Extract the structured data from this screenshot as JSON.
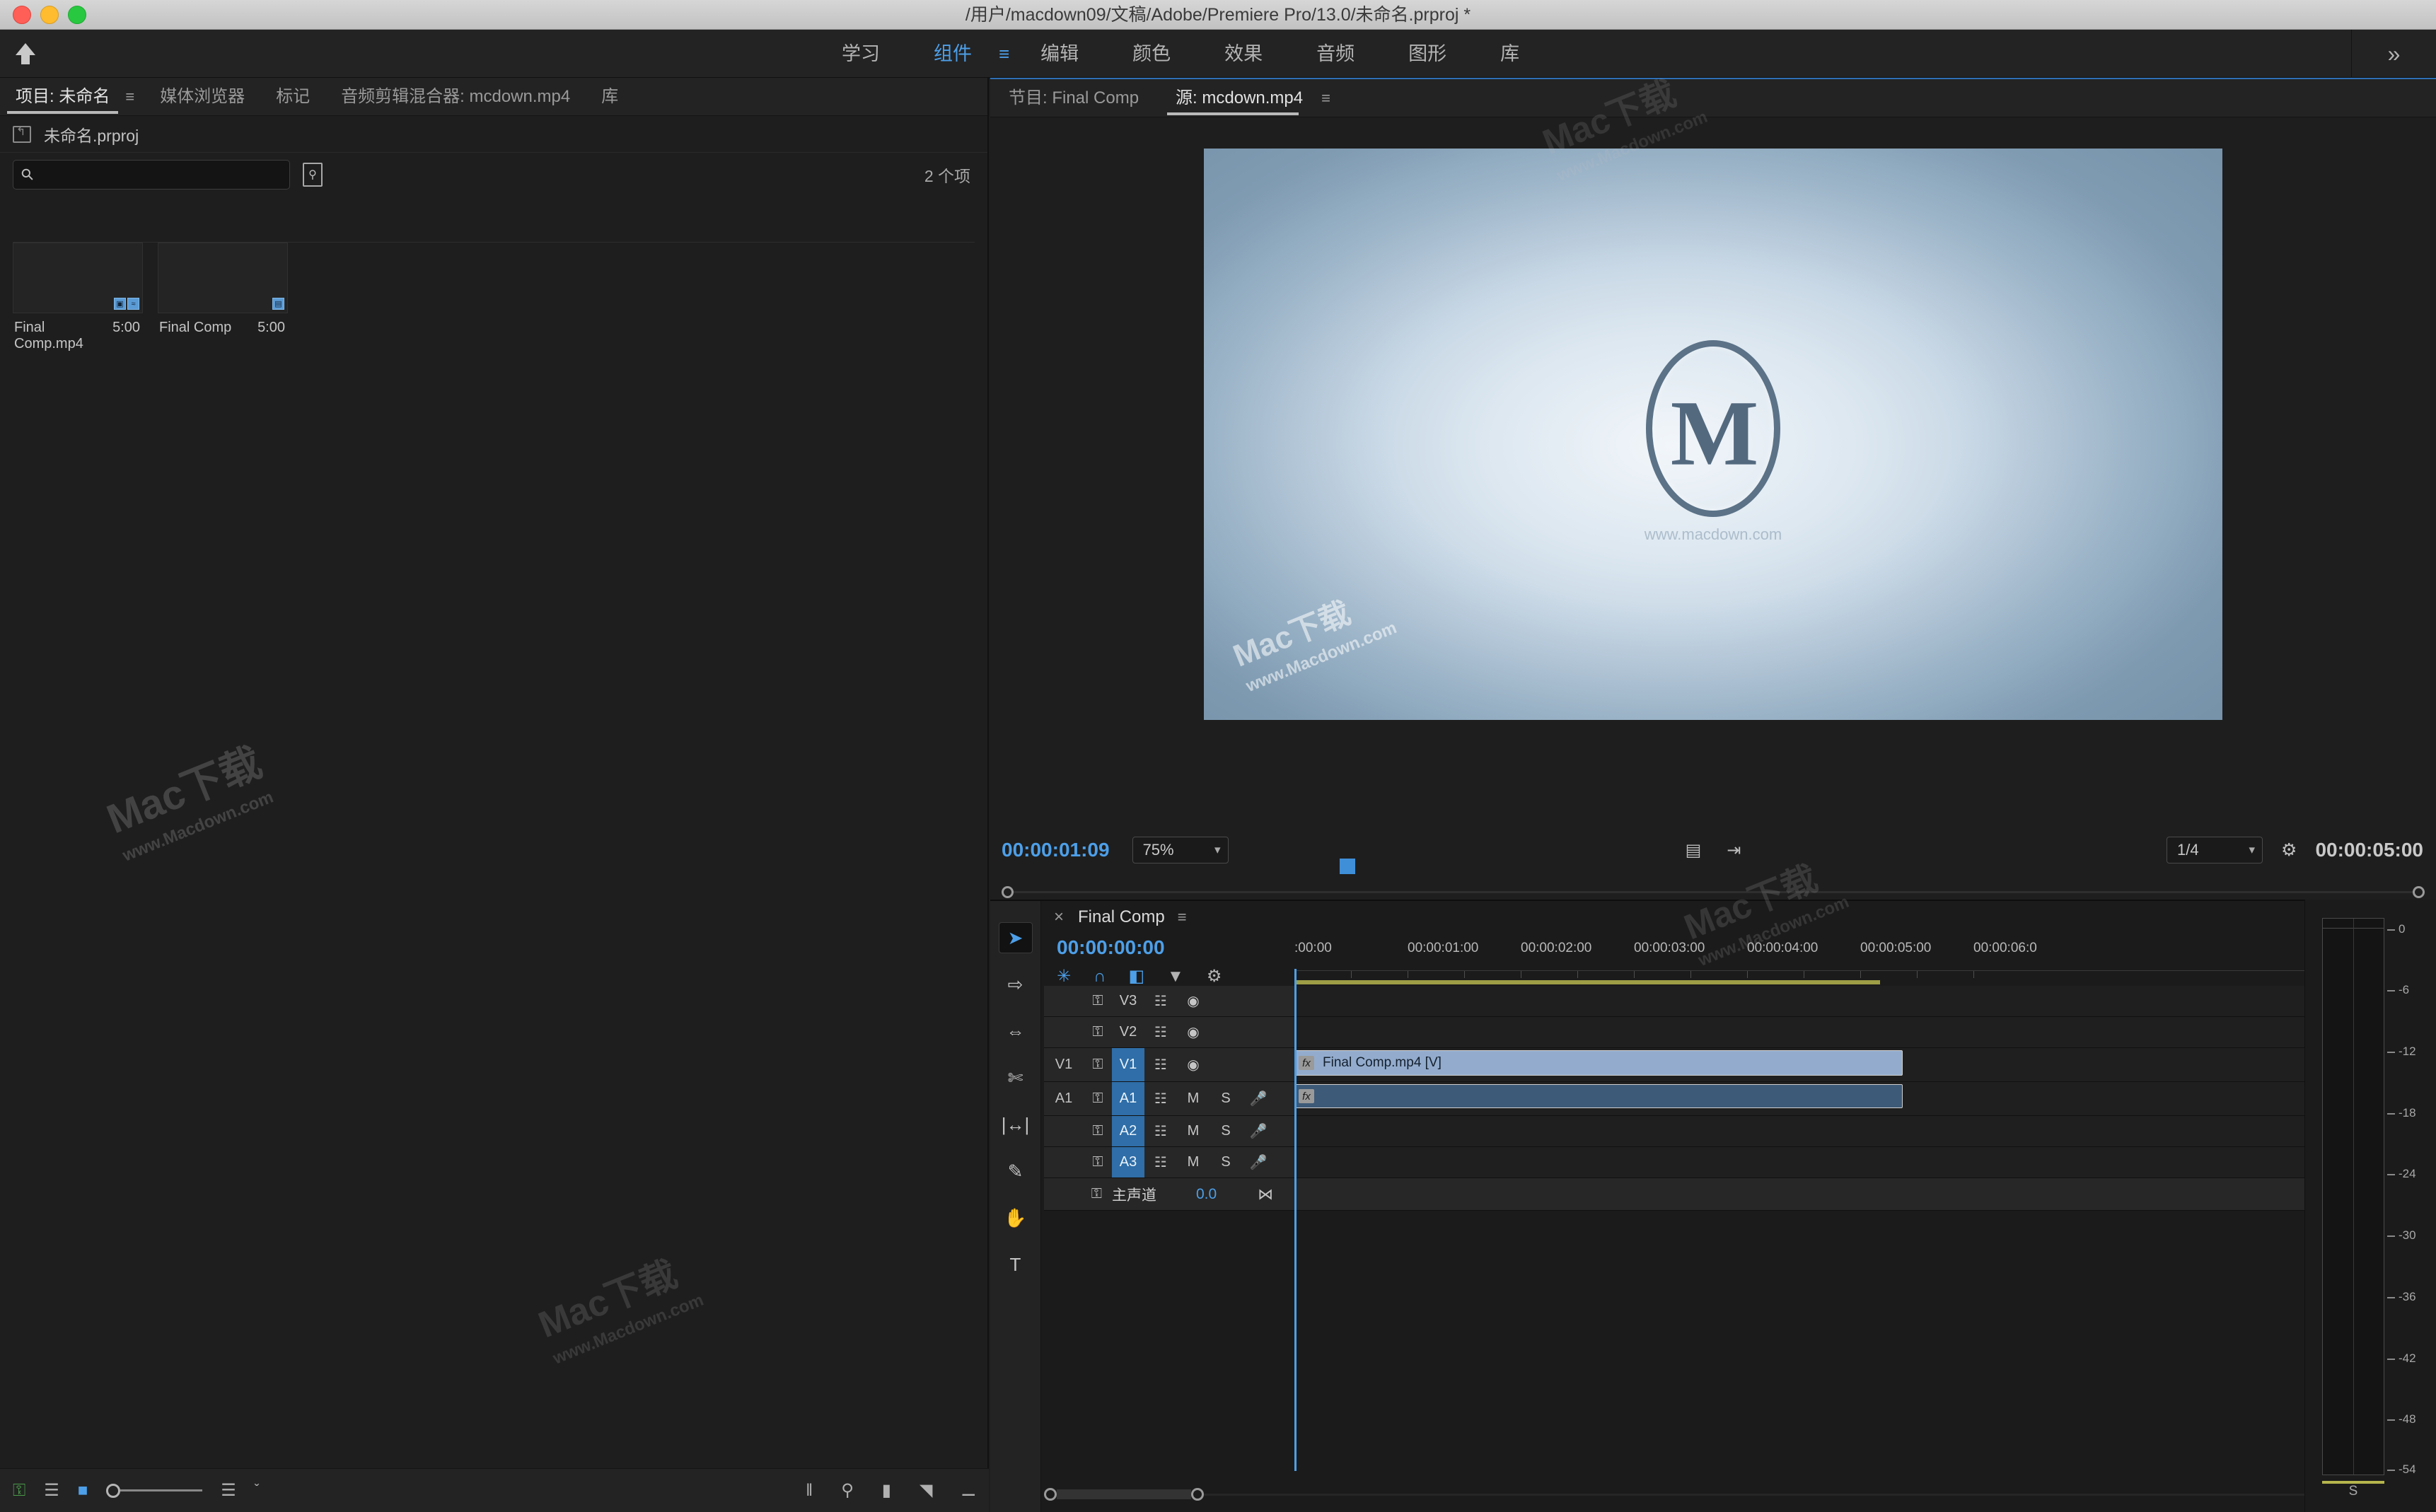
{
  "window": {
    "title": "/用户/macdown09/文稿/Adobe/Premiere Pro/13.0/未命名.prproj *"
  },
  "menubar": {
    "home_icon": "home-icon",
    "items": [
      {
        "label": "学习",
        "active": false
      },
      {
        "label": "组件",
        "active": true
      },
      {
        "label": "编辑",
        "active": false
      },
      {
        "label": "颜色",
        "active": false
      },
      {
        "label": "效果",
        "active": false
      },
      {
        "label": "音频",
        "active": false
      },
      {
        "label": "图形",
        "active": false
      },
      {
        "label": "库",
        "active": false
      }
    ],
    "burger": "≡",
    "more": "»"
  },
  "project": {
    "tabs": [
      {
        "label": "项目: 未命名",
        "active": true
      },
      {
        "label": "媒体浏览器",
        "active": false
      },
      {
        "label": "标记",
        "active": false
      },
      {
        "label": "音频剪辑混合器: mcdown.mp4",
        "active": false
      },
      {
        "label": "库",
        "active": false
      }
    ],
    "burger": "≡",
    "bin_name": "未命名.prproj",
    "search_placeholder": "",
    "search_value": "",
    "item_count": "2 个项",
    "items": [
      {
        "name": "Final Comp.mp4",
        "duration": "5:00",
        "badges": [
          "film-icon",
          "audio-wave-icon"
        ]
      },
      {
        "name": "Final Comp",
        "duration": "5:00",
        "badges": [
          "sequence-icon"
        ]
      }
    ],
    "bottom_tools": [
      {
        "name": "lock-icon",
        "glyph": "⚿"
      },
      {
        "name": "list-view-icon",
        "glyph": "☰"
      },
      {
        "name": "icon-view-icon",
        "glyph": "■"
      },
      {
        "name": "sort-icon",
        "glyph": "☰"
      },
      {
        "name": "sort-chevron-icon",
        "glyph": "ˇ"
      }
    ],
    "bottom_right_tools": [
      {
        "name": "freeform-view-icon",
        "glyph": "‖"
      },
      {
        "name": "find-icon",
        "glyph": "⚲"
      },
      {
        "name": "new-bin-icon",
        "glyph": "▮"
      },
      {
        "name": "new-item-icon",
        "glyph": "◥"
      },
      {
        "name": "delete-icon",
        "glyph": "Ὕ1"
      }
    ]
  },
  "monitor": {
    "tabs": [
      {
        "label": "节目: Final Comp",
        "active": false
      },
      {
        "label": "源: mcdown.mp4",
        "active": true
      }
    ],
    "burger": "≡",
    "playhead_timecode": "00:00:01:09",
    "zoom_level": "75%",
    "resolution": "1/4",
    "duration": "00:00:05:00",
    "logo_letter": "M",
    "logo_sub": "www.macdown.com",
    "transport": [
      {
        "name": "add-marker-icon",
        "glyph": "▼"
      },
      {
        "name": "mark-in-icon",
        "glyph": "{"
      },
      {
        "name": "mark-out-icon",
        "glyph": "}"
      },
      {
        "name": "go-to-in-icon",
        "glyph": "⇥"
      },
      {
        "name": "step-back-icon",
        "glyph": "◀"
      },
      {
        "name": "play-icon",
        "glyph": "▶"
      },
      {
        "name": "step-forward-icon",
        "glyph": "▶"
      },
      {
        "name": "go-to-out-icon",
        "glyph": "⇥"
      },
      {
        "name": "insert-icon",
        "glyph": "▣"
      },
      {
        "name": "overwrite-icon",
        "glyph": "▣"
      },
      {
        "name": "export-frame-icon",
        "glyph": "◎"
      }
    ],
    "settings_icons": [
      {
        "name": "export-frame-settings-icon",
        "glyph": "☷"
      },
      {
        "name": "fast-forward-icon",
        "glyph": "⇥"
      }
    ],
    "button_editor": "+"
  },
  "timeline": {
    "close": "×",
    "title": "Final Comp",
    "burger": "≡",
    "timecode": "00:00:00:00",
    "toolbar_icons": [
      {
        "name": "insert-overwrite-icon",
        "glyph": "✳"
      },
      {
        "name": "snap-magnet-icon",
        "glyph": "∩"
      },
      {
        "name": "linked-selection-icon",
        "glyph": "◧"
      },
      {
        "name": "marker-icon",
        "glyph": "▼"
      },
      {
        "name": "timeline-settings-icon",
        "glyph": "⚒"
      }
    ],
    "ruler_labels": [
      ":00:00",
      "00:00:01:00",
      "00:00:02:00",
      "00:00:03:00",
      "00:00:04:00",
      "00:00:05:00",
      "00:00:06:0"
    ],
    "tracks": [
      {
        "tag": "",
        "name": "V3",
        "type": "video",
        "targeted": false
      },
      {
        "tag": "",
        "name": "V2",
        "type": "video",
        "targeted": false
      },
      {
        "tag": "V1",
        "name": "V1",
        "type": "video",
        "targeted": true
      },
      {
        "tag": "A1",
        "name": "A1",
        "type": "audio",
        "targeted": true
      },
      {
        "tag": "",
        "name": "A2",
        "type": "audio",
        "targeted": true
      },
      {
        "tag": "",
        "name": "A3",
        "type": "audio",
        "targeted": true
      }
    ],
    "track_icons": {
      "lock": "⚿",
      "sync": "☷",
      "eye": "◉",
      "mute": "M",
      "solo": "S",
      "mic": "Ἲ4"
    },
    "master": {
      "name": "主声道",
      "lock": "⚿",
      "value": "0.0",
      "pan": "⋈"
    },
    "clips": [
      {
        "track": "V1",
        "label": "Final Comp.mp4 [V]",
        "fx": "fx"
      },
      {
        "track": "A1",
        "label": "",
        "fx": "fx"
      }
    ]
  },
  "tools": [
    {
      "name": "selection-tool",
      "glyph": "➤",
      "active": true
    },
    {
      "name": "track-select-forward-tool",
      "glyph": "⇨",
      "active": false
    },
    {
      "name": "ripple-edit-tool",
      "glyph": "⇔",
      "active": false
    },
    {
      "name": "razor-tool",
      "glyph": "✄",
      "active": false
    },
    {
      "name": "slip-tool",
      "glyph": "↔",
      "active": false
    },
    {
      "name": "pen-tool",
      "glyph": "✎",
      "active": false
    },
    {
      "name": "hand-tool",
      "glyph": "✋",
      "active": false
    },
    {
      "name": "type-tool",
      "glyph": "T",
      "active": false
    }
  ],
  "meters": {
    "scale_labels": [
      "0",
      "-6",
      "-12",
      "-18",
      "-24",
      "-30",
      "-36",
      "-42",
      "-48",
      "-54"
    ],
    "foot_label": "S"
  },
  "watermarks": [
    {
      "text": "Mac下载",
      "sub": "www.Macdown.com"
    }
  ],
  "colors": {
    "accent_blue": "#4d9fe8",
    "panel_bg": "#1e1e1e",
    "header_bg": "#232323",
    "clip_video": "#93accd",
    "clip_audio": "#3d5a78",
    "target_blue": "#2f6ea8"
  }
}
